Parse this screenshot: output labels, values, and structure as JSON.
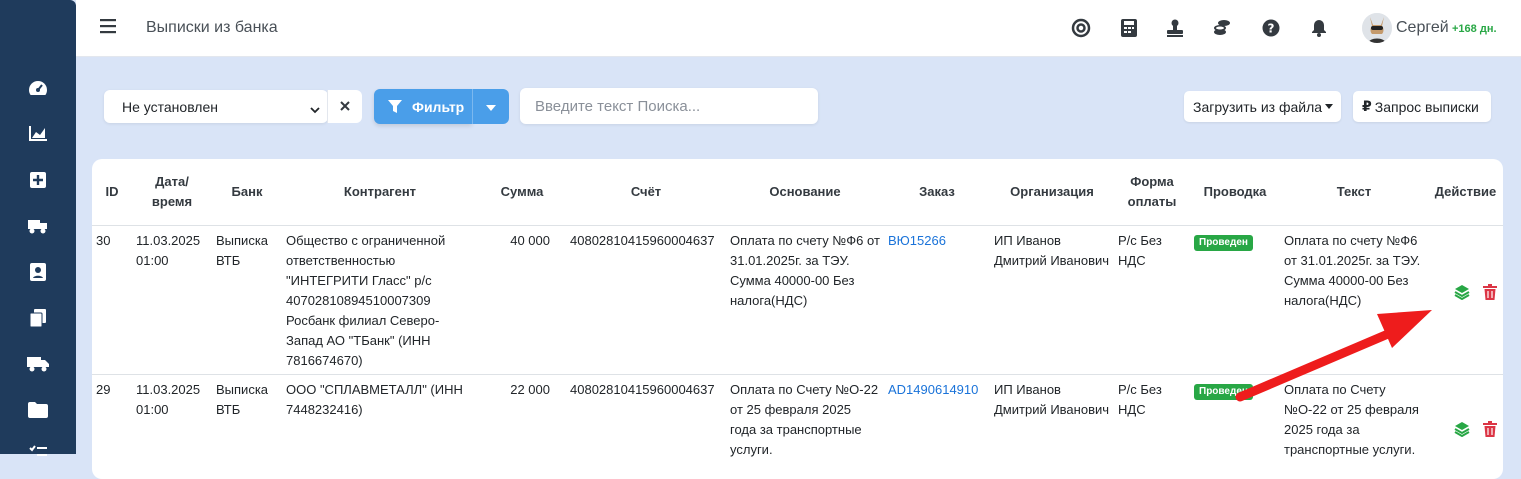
{
  "header": {
    "title": "Выписки из банка",
    "user_name": "Сергей",
    "user_days": "+168 дн."
  },
  "toolbar": {
    "bank_select_value": "Не установлен",
    "filter_label": "Фильтр",
    "search_placeholder": "Введите текст Поиска...",
    "load_label": "Загрузить из файла",
    "request_label": "Запрос выписки",
    "request_icon": "₽"
  },
  "table": {
    "headers": {
      "id": "ID",
      "datetime_1": "Дата/",
      "datetime_2": "время",
      "bank": "Банк",
      "counterparty": "Контрагент",
      "amount": "Сумма",
      "account": "Счёт",
      "reason": "Основание",
      "order": "Заказ",
      "organization": "Организация",
      "payform_1": "Форма",
      "payform_2": "оплаты",
      "posting": "Проводка",
      "text": "Текст",
      "action": "Действие"
    },
    "rows": [
      {
        "id": "30",
        "date": "11.03.2025",
        "time": "01:00",
        "bank": "Выписка ВТБ",
        "counterparty": "Общество с ограниченной ответственностью \"ИНТЕГРИТИ Гласс\" р/с 40702810894510007309 Росбанк филиал Северо-Запад АО \"ТБанк\" (ИНН 7816674670)",
        "amount": "40 000",
        "account": "40802810415960004637",
        "reason": "Оплата по счету №Ф6 от 31.01.2025г. за ТЭУ. Сумма 40000-00 Без налога(НДС)",
        "order": "ВЮ15266",
        "organization": "ИП Иванов Дмитрий Иванович",
        "payform": "Р/с Без НДС",
        "posting": "Проведен",
        "text": "Оплата по счету №Ф6 от 31.01.2025г. за ТЭУ. Сумма 40000-00 Без налога(НДС)"
      },
      {
        "id": "29",
        "date": "11.03.2025",
        "time": "01:00",
        "bank": "Выписка ВТБ",
        "counterparty": "ООО \"СПЛАВМЕТАЛЛ\" (ИНН 7448232416)",
        "amount": "22 000",
        "account": "40802810415960004637",
        "reason": "Оплата по Счету №О-22 от 25 февраля 2025 года за транспортные услуги.",
        "order": "AD1490614910",
        "organization": "ИП Иванов Дмитрий Иванович",
        "payform": "Р/с Без НДС",
        "posting": "Проведен",
        "text": "Оплата по Счету №О-22 от 25 февраля 2025 года за транспортные услуги."
      }
    ]
  },
  "colors": {
    "sidebar": "#1f3b5c",
    "accent": "#4a9ee9",
    "success": "#28a745",
    "danger": "#dc3545",
    "arrow": "#ee1c1c"
  }
}
